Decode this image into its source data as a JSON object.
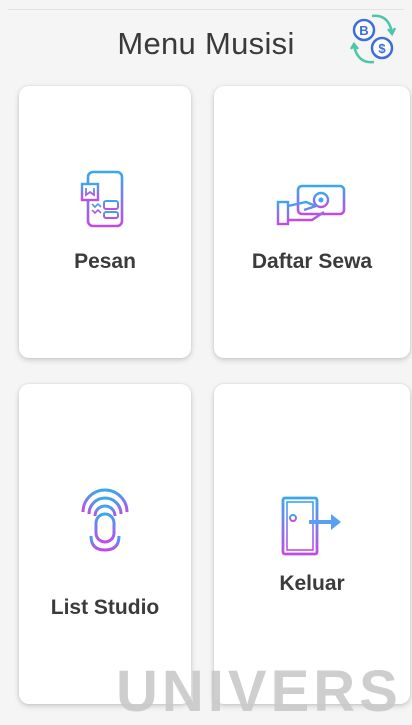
{
  "header": {
    "title": "Menu Musisi",
    "icon": "coin-exchange-icon"
  },
  "menu": [
    {
      "label": "Pesan",
      "icon": "mobile-order-icon"
    },
    {
      "label": "Daftar Sewa",
      "icon": "money-payment-icon"
    },
    {
      "label": "List Studio",
      "icon": "microphone-icon"
    },
    {
      "label": "Keluar",
      "icon": "logout-door-icon"
    }
  ],
  "watermark": "UNIVERS",
  "colors": {
    "gradient_start": "#3aa7f0",
    "gradient_end": "#c24be8",
    "coin": "#3e6fd6",
    "arrow": "#5a9ff0"
  }
}
